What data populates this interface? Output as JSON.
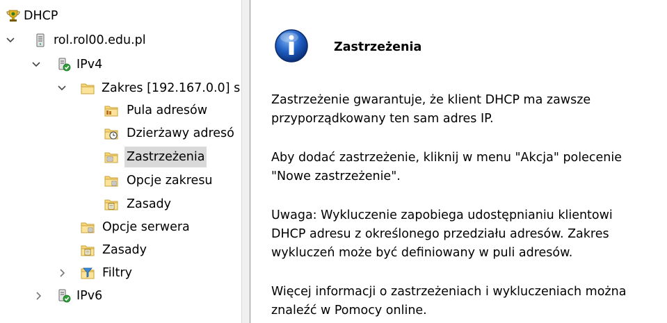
{
  "tree": {
    "root_label": "DHCP",
    "server_label": "rol.rol00.edu.pl",
    "ipv4_label": "IPv4",
    "scope_label": "Zakres [192.167.0.0] s",
    "pool_label": "Pula adresów",
    "leases_label": "Dzierżawy adresó",
    "reservations_label": "Zastrzeżenia",
    "scope_options_label": "Opcje zakresu",
    "scope_policies_label": "Zasady",
    "server_options_label": "Opcje serwera",
    "policies_label": "Zasady",
    "filters_label": "Filtry",
    "ipv6_label": "IPv6"
  },
  "info": {
    "title": "Zastrzeżenia",
    "p1": [
      "Zastrzeżenie gwarantuje, że klient DHCP ma zawsze",
      "przyporządkowany ten sam adres IP."
    ],
    "p2": [
      "Aby dodać zastrzeżenie, kliknij w menu \"Akcja\" polecenie",
      "\"Nowe zastrzeżenie\"."
    ],
    "p3": [
      "Uwaga: Wykluczenie zapobiega udostępnianiu klientowi",
      "DHCP adresu z określonego przedziału adresów. Zakres",
      "wykluczeń może być definiowany w puli adresów."
    ],
    "p4": [
      "Więcej informacji o zastrzeżeniach i wykluczeniach można",
      "znaleźć w Pomocy online."
    ]
  }
}
